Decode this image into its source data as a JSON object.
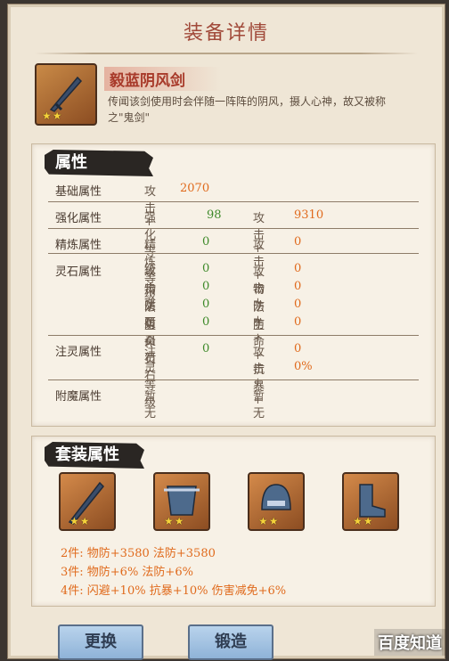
{
  "title": "装备详情",
  "equipment": {
    "name": "毅蓝阴风剑",
    "stars": "★★",
    "description": "传闻该剑使用时会伴随一阵阵的阴风，摄人心神，故又被称之\"鬼剑\""
  },
  "attributes": {
    "section_title": "属性",
    "rows": [
      {
        "label": "基础属性",
        "c1": "攻击+",
        "v1": "2070",
        "c2": "",
        "v2": ""
      },
      {
        "label": "强化属性",
        "c1": "强化等级",
        "v1": "98",
        "c2": "攻击+",
        "v2": "9310"
      },
      {
        "label": "精炼属性",
        "c1": "精炼等级",
        "v1": "0",
        "c2": "攻击+",
        "v2": "0"
      },
      {
        "label": "灵石属性",
        "c1": "攻击灵石",
        "v1": "0",
        "c2": "攻击+",
        "v2": "0"
      },
      {
        "label": "",
        "c1": "物防灵石",
        "v1": "0",
        "c2": "物防+",
        "v2": "0"
      },
      {
        "label": "",
        "c1": "法防灵石",
        "v1": "0",
        "c2": "法防+",
        "v2": "0"
      },
      {
        "label": "",
        "c1": "生命灵石",
        "v1": "0",
        "c2": "生命+",
        "v2": "0"
      },
      {
        "label": "注灵属性",
        "c1": "注灵等级",
        "v1": "0",
        "c2": "攻击+",
        "v2": "0"
      },
      {
        "label": "",
        "c1": "",
        "v1": "",
        "c2": "抗暴+",
        "v2": "0%"
      },
      {
        "label": "附魔属性",
        "c1": "暂无",
        "v1": "",
        "c2": "暂无",
        "v2": ""
      }
    ]
  },
  "set": {
    "section_title": "套装属性",
    "items": [
      {
        "icon": "sword-icon",
        "stars": "★★"
      },
      {
        "icon": "armor-icon",
        "stars": "★★"
      },
      {
        "icon": "helmet-icon",
        "stars": "★★"
      },
      {
        "icon": "boots-icon",
        "stars": "★★"
      }
    ],
    "effects": [
      "2件:  物防+3580  法防+3580",
      "3件:  物防+6%  法防+6%",
      "4件:  闪避+10%  抗暴+10%  伤害减免+6%"
    ]
  },
  "buttons": {
    "replace": "更换",
    "forge": "锻造"
  },
  "watermark": "百度知道"
}
